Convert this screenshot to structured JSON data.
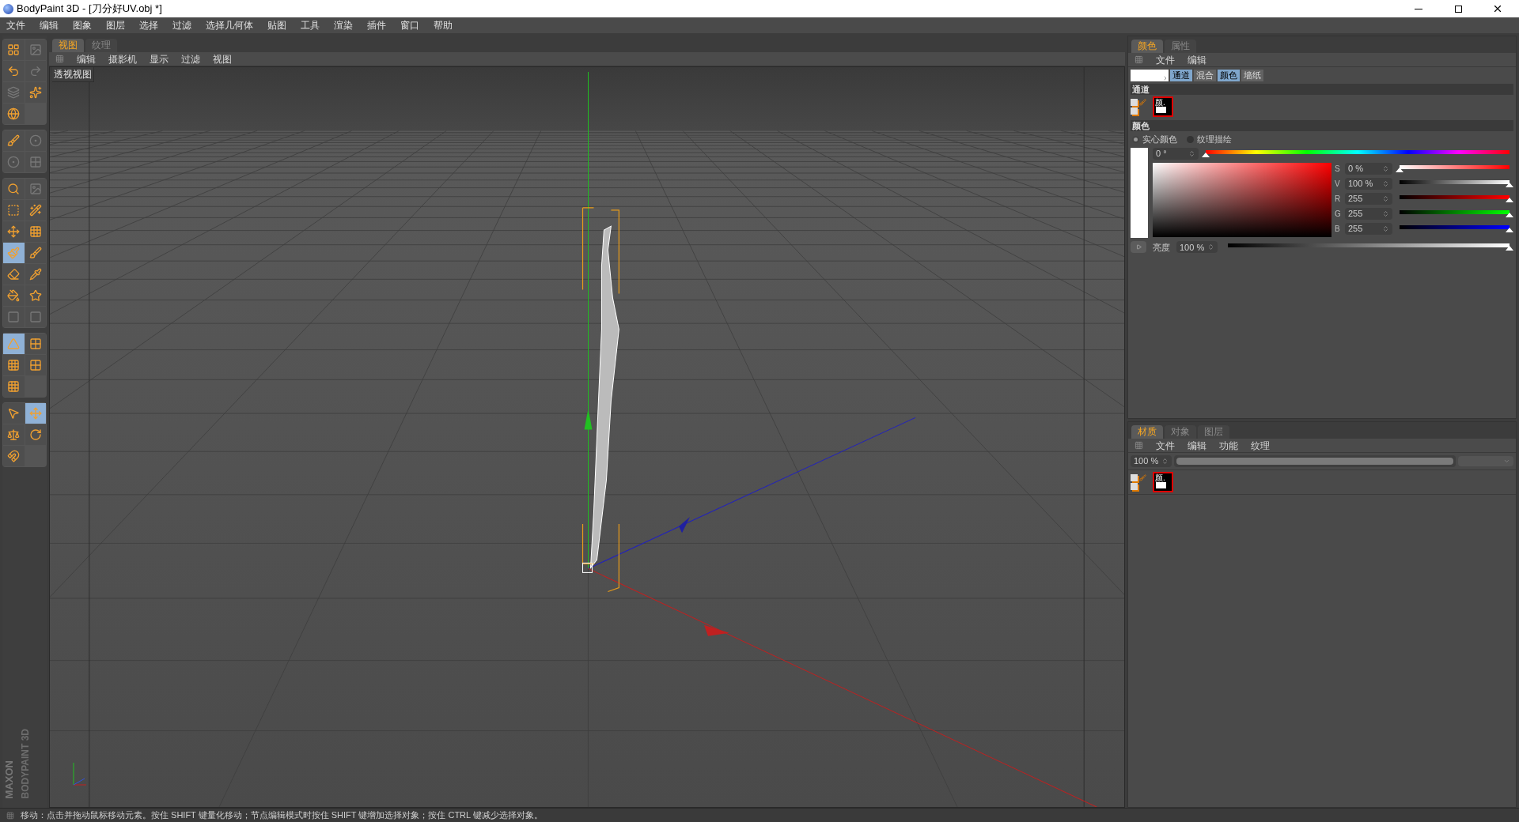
{
  "window": {
    "title": "BodyPaint 3D - [刀分好UV.obj *]"
  },
  "menu_bar": [
    "文件",
    "编辑",
    "图象",
    "图层",
    "选择",
    "过滤",
    "选择几何体",
    "贴图",
    "工具",
    "渲染",
    "插件",
    "窗口",
    "帮助"
  ],
  "tool_groups": [
    [
      {
        "selected": false
      },
      {
        "selected": false
      },
      {
        "selected": false
      },
      {
        "selected": false
      },
      {
        "selected": false
      },
      {
        "selected": false
      },
      {
        "selected": false
      }
    ],
    [
      {
        "selected": false
      },
      {
        "selected": false
      },
      {
        "selected": false
      },
      {
        "selected": false
      }
    ],
    [
      {
        "selected": false
      },
      {
        "selected": false
      },
      {
        "selected": false
      },
      {
        "selected": false
      },
      {
        "selected": false
      },
      {
        "selected": false
      },
      {
        "selected": true
      },
      {
        "selected": false
      },
      {
        "selected": false
      },
      {
        "selected": false
      },
      {
        "selected": false
      },
      {
        "selected": false
      },
      {
        "selected": false
      },
      {
        "selected": false
      }
    ],
    [
      {
        "selected": true
      },
      {
        "selected": false
      },
      {
        "selected": false
      },
      {
        "selected": false
      },
      {
        "selected": false
      }
    ],
    [
      {
        "selected": false
      },
      {
        "selected": true
      },
      {
        "selected": false
      },
      {
        "selected": false
      },
      {
        "selected": false
      }
    ]
  ],
  "branding": {
    "line_1": "MAXON",
    "line_2": "BODYPAINT 3D"
  },
  "viewport": {
    "tabs": [
      {
        "label": "视图",
        "selected": true
      },
      {
        "label": "纹理",
        "selected": false
      }
    ],
    "menu": [
      "编辑",
      "摄影机",
      "显示",
      "过滤",
      "视图"
    ],
    "view_label": "透视视图"
  },
  "color_panel": {
    "tabs": [
      {
        "label": "颜色",
        "selected": true
      },
      {
        "label": "属性",
        "selected": false
      }
    ],
    "menu": [
      "文件",
      "编辑"
    ],
    "mode_buttons": [
      {
        "label": "通道",
        "selected": true
      },
      {
        "label": "混合",
        "selected": false
      },
      {
        "label": "颜色",
        "selected": true
      },
      {
        "label": "墙纸",
        "selected": false
      }
    ],
    "channels_heading": "通道",
    "channel_thumb_label": "颜.",
    "color_heading": "颜色",
    "color_modes": [
      {
        "label": "实心颜色",
        "selected": true
      },
      {
        "label": "纹理描绘",
        "selected": false
      }
    ],
    "hue": {
      "value": "0 °",
      "level": 0
    },
    "sliders": [
      {
        "kind": "saturation",
        "label": "S",
        "value": "0 %",
        "level": 0
      },
      {
        "kind": "value",
        "label": "V",
        "value": "100 %",
        "level": 1
      },
      {
        "kind": "red",
        "label": "R",
        "value": "255",
        "level": 1
      },
      {
        "kind": "green",
        "label": "G",
        "value": "255",
        "level": 1
      },
      {
        "kind": "blue",
        "label": "B",
        "value": "255",
        "level": 1
      }
    ],
    "brightness": {
      "label": "亮度",
      "value": "100 %",
      "level": 1
    }
  },
  "material_panel": {
    "tabs": [
      {
        "label": "材质",
        "selected": true
      },
      {
        "label": "对象",
        "selected": false
      },
      {
        "label": "图层",
        "selected": false
      }
    ],
    "menu": [
      "文件",
      "编辑",
      "功能",
      "纹理"
    ],
    "opacity": {
      "value": "100 %",
      "level": 1
    },
    "material_thumb_label": "颜."
  },
  "status_bar": "移动：点击并拖动鼠标移动元素。按住 SHIFT 键量化移动；节点编辑模式时按住 SHIFT 键增加选择对象；按住 CTRL 键减少选择对象。"
}
